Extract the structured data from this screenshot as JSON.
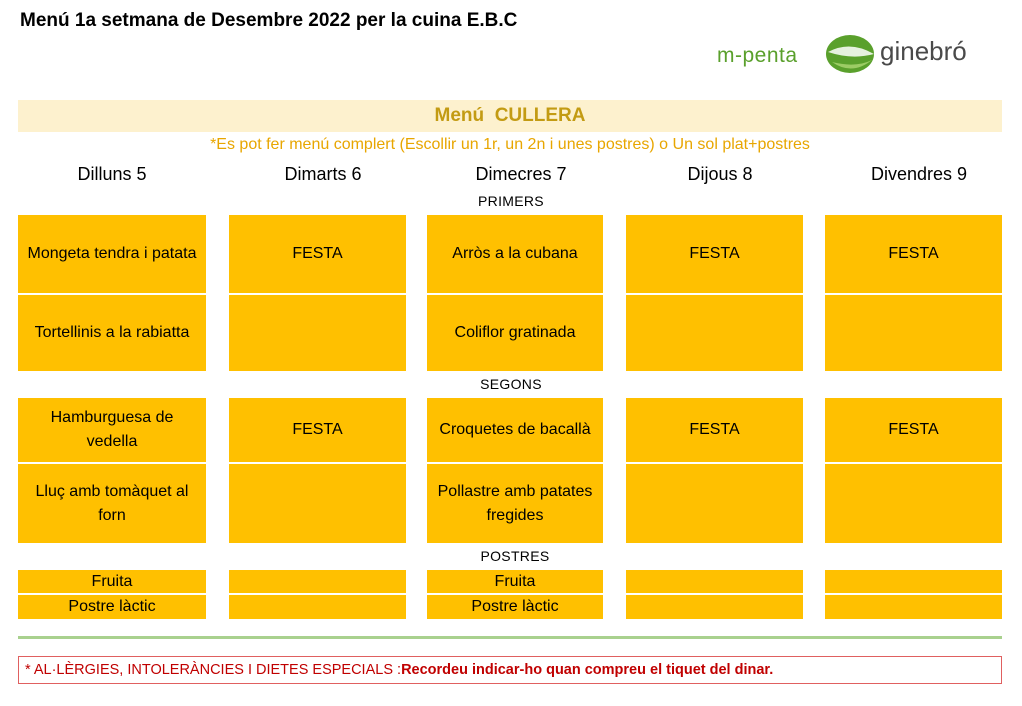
{
  "title": "Menú 1a setmana de Desembre 2022 per la cuina E.B.C",
  "logos": {
    "mpenta": "m-penta",
    "ginebro": "ginebró"
  },
  "menu_header": "Menú  CULLERA",
  "menu_note": "*Es pot fer menú complert (Escollir un 1r, un 2n i unes postres) o  Un sol plat+postres",
  "days": [
    "Dilluns 5",
    "Dimarts 6",
    "Dimecres 7",
    "Dijous 8",
    "Divendres 9"
  ],
  "sections": {
    "primers": "PRIMERS",
    "segons": "SEGONS",
    "postres": "POSTRES"
  },
  "primers": {
    "row1": [
      "Mongeta tendra i patata",
      "FESTA",
      "Arròs a la cubana",
      "FESTA",
      "FESTA"
    ],
    "row2": [
      "Tortellinis a la rabiatta",
      "",
      "Coliflor gratinada",
      "",
      ""
    ]
  },
  "segons": {
    "row1": [
      "Hamburguesa de vedella",
      "FESTA",
      "Croquetes de bacallà",
      "FESTA",
      "FESTA"
    ],
    "row2": [
      "Lluç amb tomàquet al forn",
      "",
      "Pollastre amb patates fregides",
      "",
      ""
    ]
  },
  "postres": {
    "row1": [
      "Fruita",
      "",
      "Fruita",
      "",
      ""
    ],
    "row2": [
      "Postre làctic",
      "",
      "Postre làctic",
      "",
      ""
    ]
  },
  "allergy": {
    "label": "* AL·LÈRGIES, INTOLERÀNCIES I DIETES ESPECIALS : ",
    "message": "Recordeu indicar-ho quan compreu el tiquet del dinar."
  },
  "colors": {
    "cell": "#ffc000",
    "header_bg": "#fdf1ce",
    "header_text": "#c39b13",
    "note_text": "#e8a600",
    "divider": "#a9d18e",
    "alert": "#c00000"
  }
}
